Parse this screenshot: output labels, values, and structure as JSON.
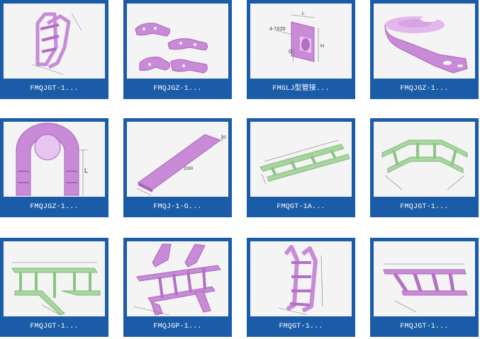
{
  "products": [
    {
      "caption": "FMQJGT-1...",
      "icon": "vertical-bend-ladder-tray",
      "color": "#c98ad8"
    },
    {
      "caption": "FMQJGZ-1...",
      "icon": "connector-plates",
      "color": "#c98ad8"
    },
    {
      "caption": "FMGLJ型管接...",
      "icon": "pipe-joint-plate",
      "color": "#c98ad8"
    },
    {
      "caption": "FMQJGZ-1...",
      "icon": "bracket-fitting",
      "color": "#c98ad8"
    },
    {
      "caption": "FMQJGZ-1...",
      "icon": "u-bend-fitting",
      "color": "#c98ad8"
    },
    {
      "caption": "FMQJ-1-G...",
      "icon": "cover-plate",
      "color": "#c98ad8"
    },
    {
      "caption": "FMQGT-1A...",
      "icon": "straight-ladder-tray",
      "color": "#a9d6a0"
    },
    {
      "caption": "FMQJGT-1...",
      "icon": "horizontal-bend-tray",
      "color": "#a9d6a0"
    },
    {
      "caption": "FMQJGT-1...",
      "icon": "tee-tray",
      "color": "#a9d6a0"
    },
    {
      "caption": "FMQJGP-1...",
      "icon": "cross-tray",
      "color": "#c98ad8"
    },
    {
      "caption": "FMQGT-1...",
      "icon": "vertical-ladder-tray",
      "color": "#c98ad8"
    },
    {
      "caption": "FMQJGT-1...",
      "icon": "reducer-ladder-tray",
      "color": "#c98ad8"
    }
  ],
  "labels": {
    "l": "L",
    "h": "H",
    "g": "G",
    "dim1": "4-7X20",
    "len": "2000",
    "w": "20"
  }
}
